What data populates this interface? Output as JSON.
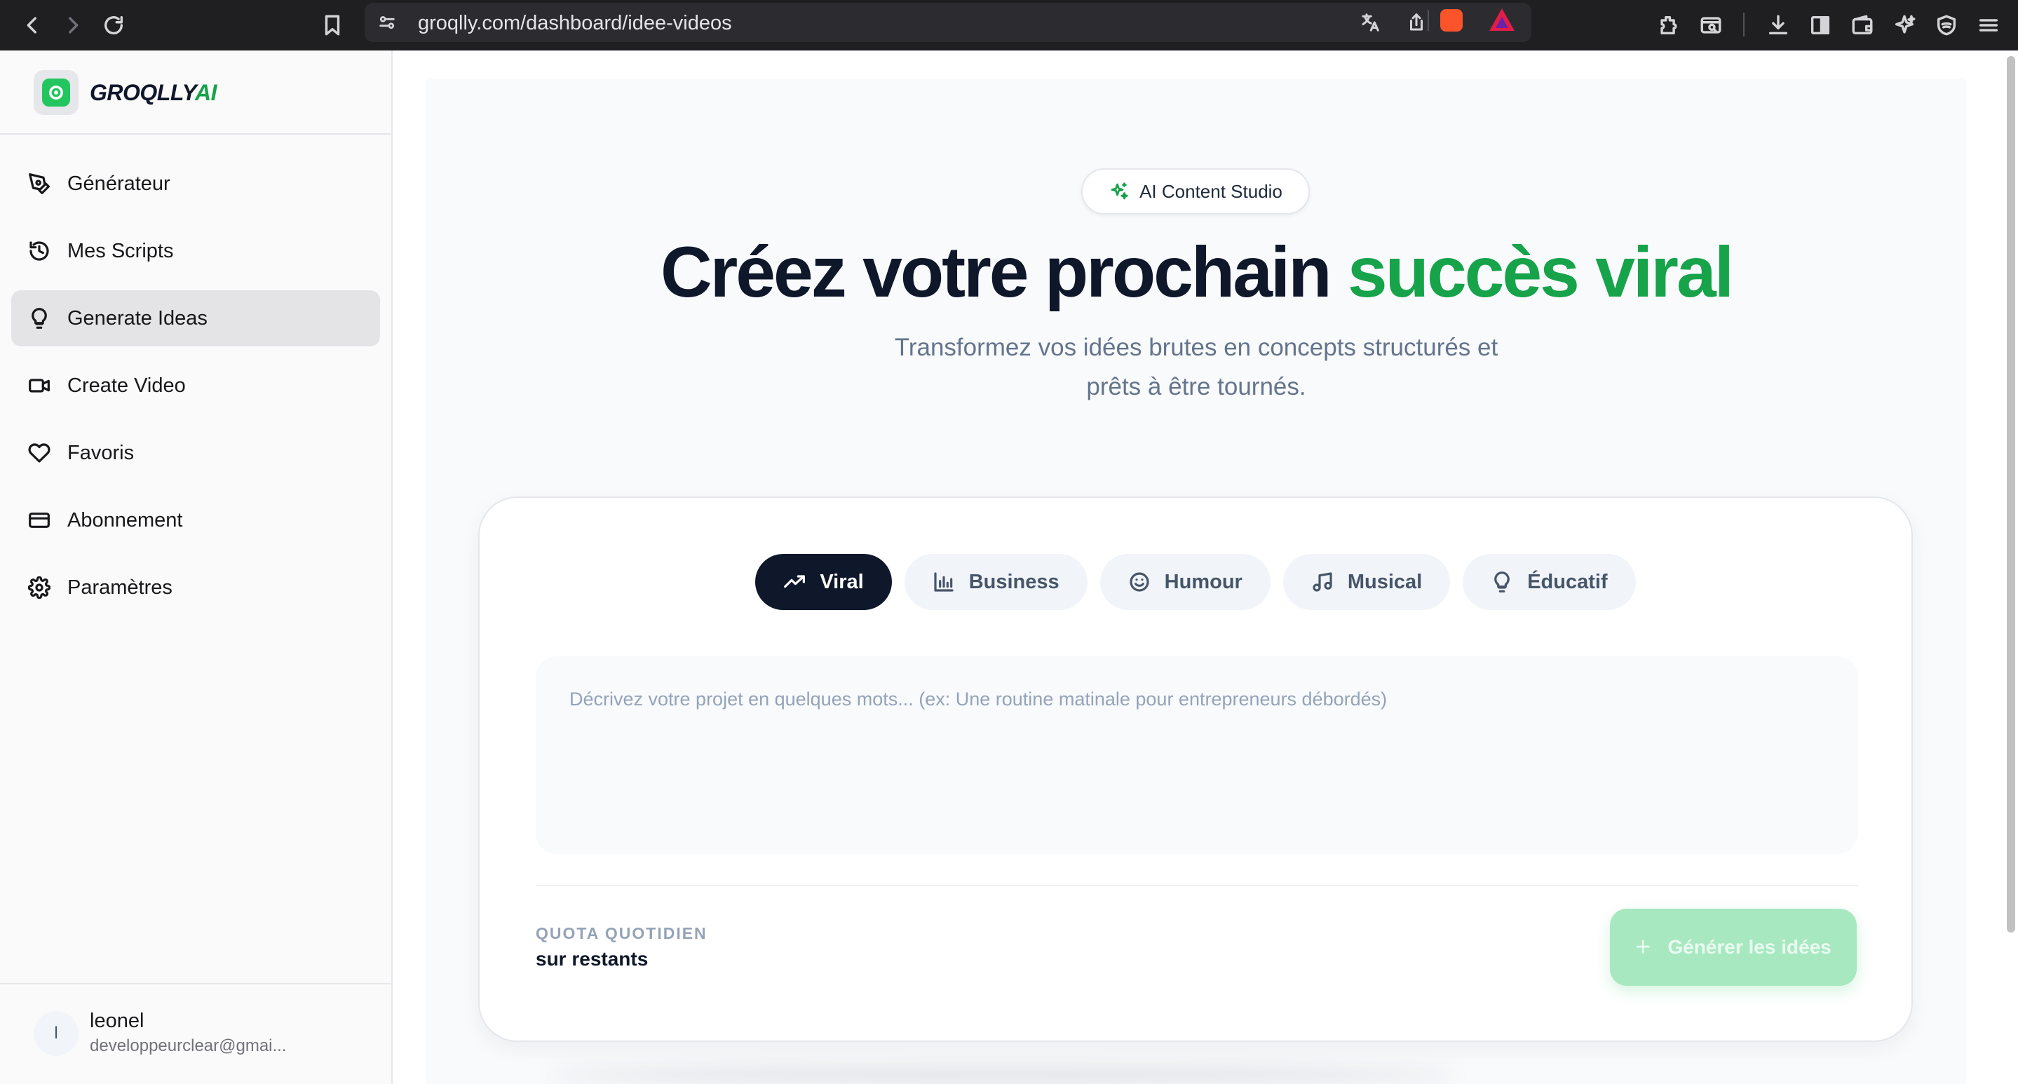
{
  "browser": {
    "url": "groqlly.com/dashboard/idee-videos"
  },
  "sidebar": {
    "brand_main": "GROQLLY",
    "brand_accent": "AI",
    "items": [
      {
        "label": "Générateur",
        "icon": "pen-tool-icon"
      },
      {
        "label": "Mes Scripts",
        "icon": "history-icon"
      },
      {
        "label": "Generate Ideas",
        "icon": "lightbulb-icon",
        "active": true
      },
      {
        "label": "Create Video",
        "icon": "video-camera-icon"
      },
      {
        "label": "Favoris",
        "icon": "heart-icon"
      },
      {
        "label": "Abonnement",
        "icon": "credit-card-icon"
      },
      {
        "label": "Paramètres",
        "icon": "gear-icon"
      }
    ],
    "user": {
      "initial": "l",
      "name": "leonel",
      "email": "developpeurclear@gmai..."
    }
  },
  "main": {
    "badge": "AI Content Studio",
    "headline_part1": "Créez votre prochain",
    "headline_part2": "succès viral",
    "subtitle_line1": "Transformez vos idées brutes en concepts structurés et",
    "subtitle_line2": "prêts à être tournés.",
    "tabs": [
      {
        "label": "Viral",
        "icon": "trending-up-icon",
        "active": true
      },
      {
        "label": "Business",
        "icon": "bar-chart-icon"
      },
      {
        "label": "Humour",
        "icon": "smile-icon"
      },
      {
        "label": "Musical",
        "icon": "music-note-icon"
      },
      {
        "label": "Éducatif",
        "icon": "lightbulb-icon"
      }
    ],
    "prompt": {
      "value": "",
      "placeholder": "Décrivez votre projet en quelques mots... (ex: Une routine matinale pour entrepreneurs débordés)"
    },
    "quota_label": "QUOTA QUOTIDIEN",
    "quota_value": "sur restants",
    "generate_label": "Générer les idées"
  },
  "colors": {
    "accent_green": "#16a34a",
    "dark": "#0f172a",
    "button_disabled_green": "#a7e8c0"
  }
}
